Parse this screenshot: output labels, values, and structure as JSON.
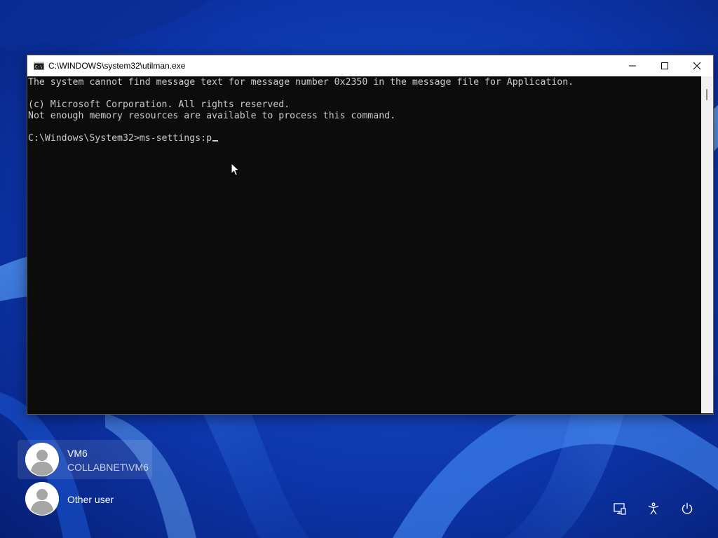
{
  "window": {
    "title": "C:\\WINDOWS\\system32\\utilman.exe",
    "app_icon": "console-icon",
    "controls": {
      "minimize": "minimize-icon",
      "maximize": "maximize-icon",
      "close": "close-icon"
    }
  },
  "console": {
    "lines": [
      "The system cannot find message text for message number 0x2350 in the message file for Application.",
      "",
      "(c) Microsoft Corporation. All rights reserved.",
      "Not enough memory resources are available to process this command.",
      "",
      "C:\\Windows\\System32>ms-settings:p"
    ],
    "text_color": "#cccccc",
    "background": "#0c0c0c"
  },
  "login": {
    "users": [
      {
        "name": "VM6",
        "domain": "COLLABNET\\VM6",
        "selected": true
      },
      {
        "name": "Other user",
        "domain": "",
        "selected": false
      }
    ]
  },
  "tray": {
    "icons": [
      "network-icon",
      "accessibility-icon",
      "power-icon"
    ]
  },
  "colors": {
    "wallpaper_dark": "#062a8a",
    "wallpaper_light": "#3f86e6"
  }
}
